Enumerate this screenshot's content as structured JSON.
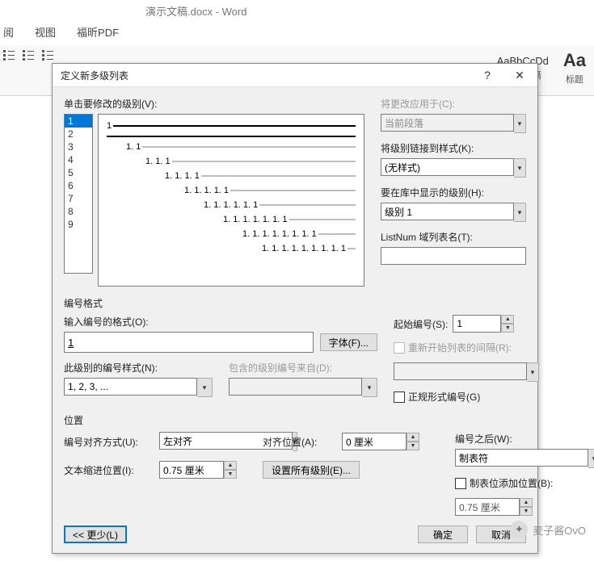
{
  "window": {
    "title": "演示文稿.docx - Word"
  },
  "tabs": {
    "review": "阅",
    "view": "视图",
    "foxit": "福昕PDF"
  },
  "ribbon": {
    "styles": {
      "aabbccdd": "AaBbCcDd",
      "nospacing": "↲ 无间隔",
      "aa": "Aa",
      "heading": "标题"
    }
  },
  "dlg": {
    "title": "定义新多级列表",
    "help": "?",
    "close": "✕",
    "click_level_label": "单击要修改的级别(V):",
    "levels": [
      "1",
      "2",
      "3",
      "4",
      "5",
      "6",
      "7",
      "8",
      "9"
    ],
    "apply_to_label": "将更改应用于(C):",
    "apply_to_value": "当前段落",
    "link_style_label": "将级别链接到样式(K):",
    "link_style_value": "(无样式)",
    "gallery_label": "要在库中显示的级别(H):",
    "gallery_value": "级别 1",
    "listnum_label": "ListNum 域列表名(T):",
    "listnum_value": "",
    "numfmt_group": "编号格式",
    "enter_fmt_label": "输入编号的格式(O):",
    "enter_fmt_value": "1",
    "font_btn": "字体(F)...",
    "numstyle_label": "此级别的编号样式(N):",
    "numstyle_value": "1, 2, 3, ...",
    "include_from_label": "包含的级别编号来自(D):",
    "include_from_value": "",
    "start_at_label": "起始编号(S):",
    "start_at_value": "1",
    "restart_label": "重新开始列表的间隔(R):",
    "restart_value": "",
    "legal_label": "正规形式编号(G)",
    "pos_group": "位置",
    "align_label": "编号对齐方式(U):",
    "align_value": "左对齐",
    "align_at_label": "对齐位置(A):",
    "align_at_value": "0 厘米",
    "follow_label": "编号之后(W):",
    "follow_value": "制表符",
    "indent_label": "文本缩进位置(I):",
    "indent_value": "0.75 厘米",
    "set_all_btn": "设置所有级别(E)...",
    "tab_at_label": "制表位添加位置(B):",
    "tab_at_value": "0.75 厘米",
    "less_btn": "<< 更少(L)",
    "ok_btn": "确定",
    "cancel_btn": "取消",
    "preview_nums": [
      "1",
      "1. 1",
      "1. 1. 1",
      "1. 1. 1. 1",
      "1. 1. 1. 1. 1",
      "1. 1. 1. 1. 1. 1",
      "1. 1. 1. 1. 1. 1. 1",
      "1. 1. 1. 1. 1. 1. 1. 1",
      "1. 1. 1. 1. 1. 1. 1. 1. 1"
    ]
  },
  "watermark": "麦子酱OvO"
}
